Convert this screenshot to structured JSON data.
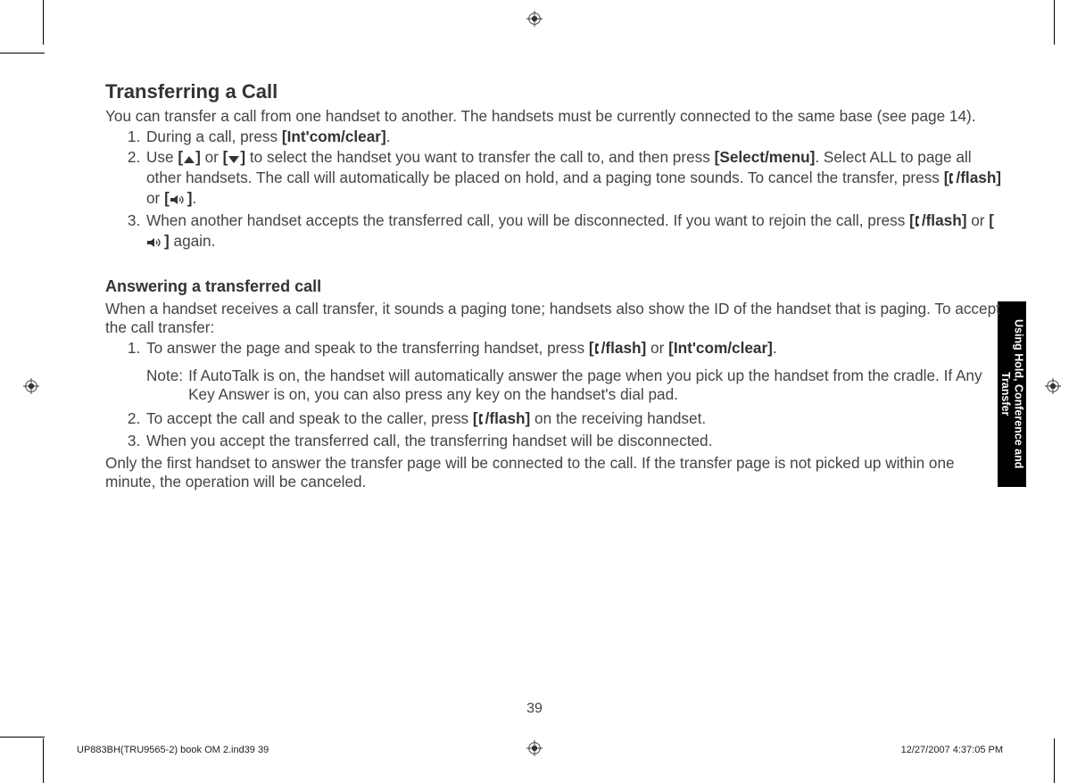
{
  "section": {
    "title": "Transferring a Call",
    "intro": "You can transfer a call from one handset to another. The handsets must be currently connected to the same base (see page 14).",
    "steps": [
      {
        "pre": "During a call, press ",
        "b1": "[Int'com/clear]",
        "post": "."
      },
      {
        "pre": "Use ",
        "icon1_open": "[",
        "icon1_close": "]",
        "mid1": " or ",
        "icon2_open": "[",
        "icon2_close": "]",
        "mid2": " to select the handset you want to transfer the call to, and then press ",
        "b1": "[Select/menu]",
        "mid3": ". Select ALL to page all other handsets. The call will automatically be placed on hold, and a paging tone sounds. To cancel the transfer, press ",
        "b2_open": "[",
        "b2_label": "/flash]",
        "mid4": " or ",
        "b3_open": "[",
        "b3_close": "]",
        "post": "."
      },
      {
        "pre": "When another handset accepts the transferred call, you will be disconnected. If you want to rejoin the call, press ",
        "b1_open": "[",
        "b1_label": "/flash]",
        "mid1": " or ",
        "b2_open": "[",
        "b2_close": "]",
        "post": " again."
      }
    ]
  },
  "subsection": {
    "title": "Answering a transferred call",
    "intro": "When a handset receives a call transfer, it sounds a paging tone; handsets also show the ID of the handset that is paging. To accept the call transfer:",
    "steps": [
      {
        "pre": "To answer the page and speak to the transferring handset, press ",
        "b1_open": "[",
        "b1_label": "/flash]",
        "mid1": " or ",
        "b2": "[Int'com/clear]",
        "post": "."
      },
      {
        "pre": "To accept the call and speak to the caller, press ",
        "b1_open": "[",
        "b1_label": "/flash]",
        "post": " on the receiving handset."
      },
      {
        "pre": "When you accept the transferred call, the transferring handset will be disconnected."
      }
    ],
    "note_label": "Note:",
    "note_text": "If AutoTalk is on, the handset will automatically answer the page when you pick up the handset from the cradle. If Any Key Answer is on, you can also press any key on the handset's dial pad.",
    "outro": "Only the first handset to answer the transfer page will be connected to the call. If the transfer page is not picked up within one minute, the operation will be canceled."
  },
  "side_tab": "Using Hold, Conference and Transfer",
  "page_number": "39",
  "footer": {
    "left": "UP883BH(TRU9565-2) book OM 2.ind39   39",
    "right": "12/27/2007   4:37:05 PM"
  }
}
